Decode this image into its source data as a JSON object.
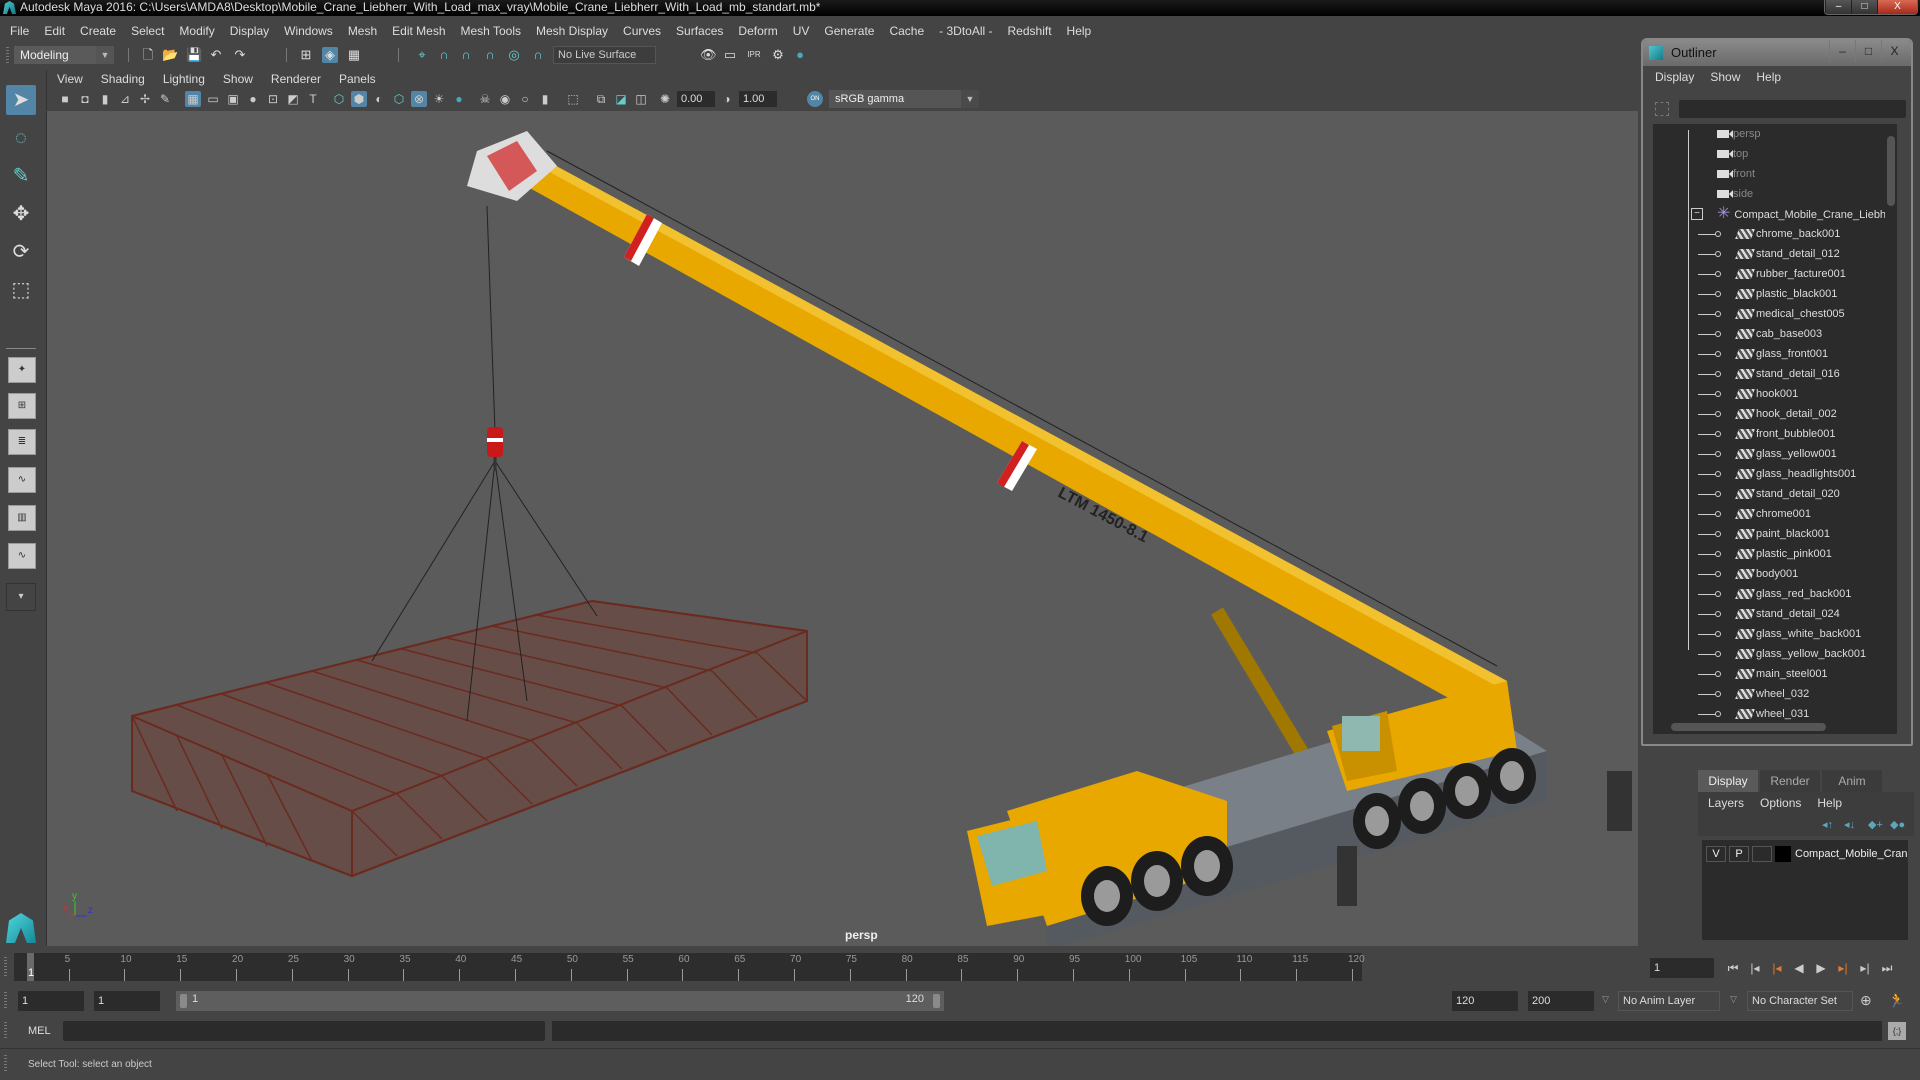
{
  "window": {
    "title": "Autodesk Maya 2016: C:\\Users\\AMDA8\\Desktop\\Mobile_Crane_Liebherr_With_Load_max_vray\\Mobile_Crane_Liebherr_With_Load_mb_standart.mb*",
    "minimize": "–",
    "maximize": "□",
    "close": "X"
  },
  "menubar": [
    "File",
    "Edit",
    "Create",
    "Select",
    "Modify",
    "Display",
    "Windows",
    "Mesh",
    "Edit Mesh",
    "Mesh Tools",
    "Mesh Display",
    "Curves",
    "Surfaces",
    "Deform",
    "UV",
    "Generate",
    "Cache",
    "- 3DtoAll -",
    "Redshift",
    "Help"
  ],
  "toolbar": {
    "mode": "Modeling",
    "live_surface": "No Live Surface",
    "icons": [
      "new-scene",
      "open-scene",
      "save-scene",
      "undo",
      "redo",
      "select-by-hierarchy",
      "select-by-object",
      "select-by-component",
      "snap-to-grid",
      "snap-to-curve",
      "snap-to-point",
      "snap-to-view-plane",
      "make-live",
      "snap-to-surface",
      "render-view",
      "render-frame",
      "ipr-render",
      "render-settings",
      "hypershade"
    ]
  },
  "panel_menu": [
    "View",
    "Shading",
    "Lighting",
    "Show",
    "Renderer",
    "Panels"
  ],
  "view_toolbar": {
    "exposure": "0.00",
    "gamma": "1.00",
    "color_management": "ON",
    "color_space": "sRGB gamma"
  },
  "toolbox": [
    "select-tool",
    "lasso-tool",
    "paint-select-tool",
    "move-tool",
    "rotate-tool",
    "scale-tool"
  ],
  "viewport": {
    "camera": "persp",
    "boom_label": "LTM 1450-8.1",
    "axis": {
      "x": "x",
      "y": "y",
      "z": "z"
    }
  },
  "outliner": {
    "title": "Outliner",
    "menu": [
      "Display",
      "Show",
      "Help"
    ],
    "cameras": [
      "persp",
      "top",
      "front",
      "side"
    ],
    "group": "Compact_Mobile_Crane_Liebherr_W",
    "items": [
      "chrome_back001",
      "stand_detail_012",
      "rubber_facture001",
      "plastic_black001",
      "medical_chest005",
      "cab_base003",
      "glass_front001",
      "stand_detail_016",
      "hook001",
      "hook_detail_002",
      "front_bubble001",
      "glass_yellow001",
      "glass_headlights001",
      "stand_detail_020",
      "chrome001",
      "paint_black001",
      "plastic_pink001",
      "body001",
      "glass_red_back001",
      "stand_detail_024",
      "glass_white_back001",
      "glass_yellow_back001",
      "main_steel001",
      "wheel_032",
      "wheel_031"
    ]
  },
  "layer_editor": {
    "tabs": [
      "Display",
      "Render",
      "Anim"
    ],
    "active_tab": "Display",
    "menu": [
      "Layers",
      "Options",
      "Help"
    ],
    "layer": {
      "v": "V",
      "p": "P",
      "name": "Compact_Mobile_Cran",
      "color": "#000000"
    }
  },
  "timeline": {
    "ticks": [
      "5",
      "10",
      "15",
      "20",
      "25",
      "30",
      "35",
      "40",
      "45",
      "50",
      "55",
      "60",
      "65",
      "70",
      "75",
      "80",
      "85",
      "90",
      "95",
      "100",
      "105",
      "110",
      "115",
      "120"
    ],
    "current_marker": "1",
    "current_frame": "1",
    "playback": [
      "go-to-start",
      "step-back-frame",
      "step-back-key",
      "play-backwards",
      "play-forwards",
      "step-forward-key",
      "step-forward-frame",
      "go-to-end"
    ]
  },
  "range": {
    "start": "1",
    "playback_start": "1",
    "slider_start": "1",
    "slider_end": "120",
    "playback_end": "120",
    "end": "200",
    "anim_layer": "No Anim Layer",
    "character_set": "No Character Set"
  },
  "command_line": {
    "label": "MEL",
    "value": ""
  },
  "help_line": "Select Tool: select an object",
  "colors": {
    "accent": "#5285a6",
    "crane_yellow": "#e8a800",
    "load_red": "#8b3a2a",
    "viewport_bg": "#5b5b5b"
  }
}
